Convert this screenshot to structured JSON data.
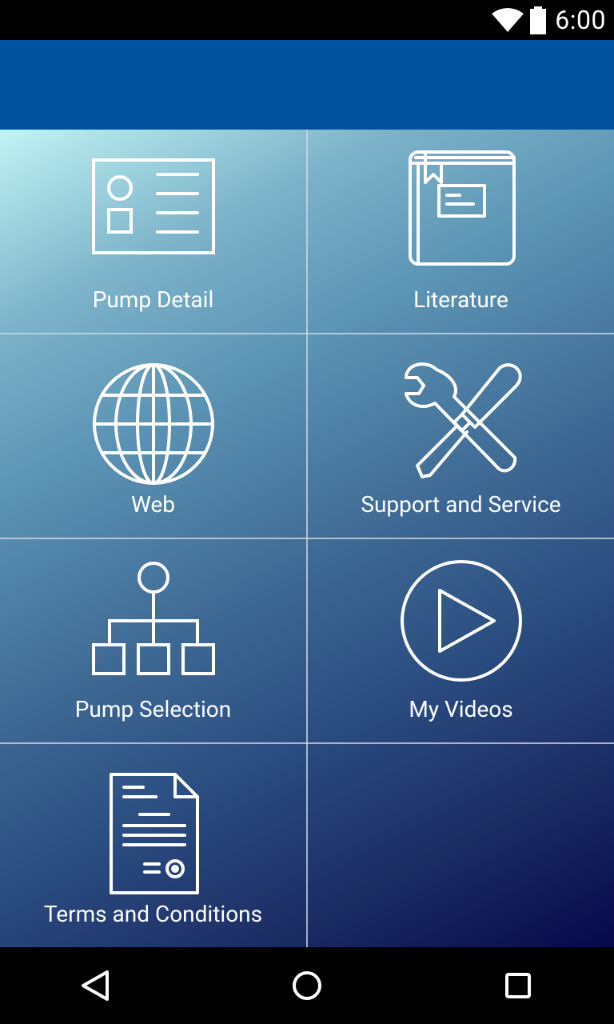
{
  "status_bar": {
    "time": "6:00",
    "wifi_icon": "wifi-icon",
    "battery_icon": "battery-icon"
  },
  "app_bar": {
    "color": "#02539f"
  },
  "tiles": [
    {
      "label": "Pump Detail",
      "icon": "id-card-icon"
    },
    {
      "label": "Literature",
      "icon": "book-icon"
    },
    {
      "label": "Web",
      "icon": "globe-icon"
    },
    {
      "label": "Support and Service",
      "icon": "wrench-screwdriver-icon"
    },
    {
      "label": "Pump Selection",
      "icon": "hierarchy-icon"
    },
    {
      "label": "My Videos",
      "icon": "play-icon"
    },
    {
      "label": "Terms and Conditions",
      "icon": "document-icon"
    }
  ],
  "nav_bar": {
    "back_icon": "back-icon",
    "home_icon": "home-icon",
    "recents_icon": "recents-icon"
  }
}
